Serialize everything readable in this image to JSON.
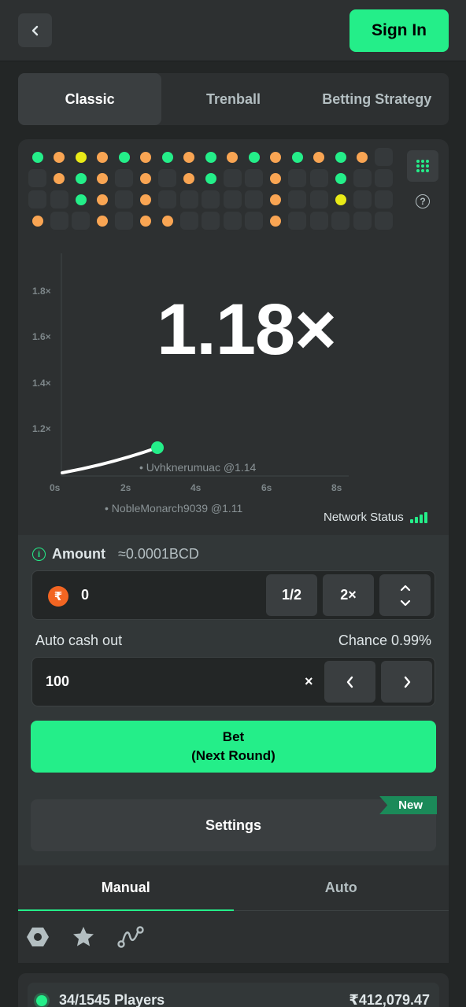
{
  "header": {
    "signin_label": "Sign In"
  },
  "tabs": [
    {
      "label": "Classic",
      "active": true
    },
    {
      "label": "Trenball",
      "active": false
    },
    {
      "label": "Betting Strategy",
      "active": false
    }
  ],
  "history": {
    "colors": {
      "g": "#24ee89",
      "o": "#f9a553",
      "y": "#e9ea17"
    },
    "rows": [
      [
        "g",
        "o",
        "y",
        "o",
        "g",
        "o",
        "g",
        "o",
        "g",
        "o",
        "g",
        "o",
        "g",
        "o",
        "g",
        "o",
        ""
      ],
      [
        "",
        "o",
        "g",
        "o",
        "",
        "o",
        "",
        "o",
        "g",
        "",
        "",
        "o",
        "",
        "",
        "g",
        "",
        ""
      ],
      [
        "",
        "",
        "g",
        "o",
        "",
        "o",
        "",
        "",
        "",
        "",
        "",
        "o",
        "",
        "",
        "y",
        "",
        ""
      ],
      [
        "o",
        "",
        "",
        "o",
        "",
        "o",
        "o",
        "",
        "",
        "",
        "",
        "o",
        "",
        "",
        "",
        "",
        ""
      ]
    ]
  },
  "graph": {
    "multiplier": "1.18×",
    "y_ticks": [
      "1.8×",
      "1.6×",
      "1.4×",
      "1.2×"
    ],
    "x_ticks": [
      "0s",
      "2s",
      "4s",
      "6s",
      "8s"
    ],
    "player_tags": [
      "• Uvhknerumuac @1.14",
      "• NobleMonarch9039 @1.11"
    ],
    "network_status": "Network Status"
  },
  "bet": {
    "amount_label": "Amount",
    "amount_approx": "≈0.0001BCD",
    "currency_symbol": "₹",
    "amount_value": "0",
    "half_label": "1/2",
    "double_label": "2×",
    "auto_cashout_label": "Auto cash out",
    "chance_label": "Chance 0.99%",
    "cashout_value": "100",
    "times_symbol": "×",
    "bet_label_line1": "Bet",
    "bet_label_line2": "(Next Round)",
    "settings_label": "Settings",
    "new_badge": "New"
  },
  "modes": [
    {
      "label": "Manual",
      "active": true
    },
    {
      "label": "Auto",
      "active": false
    }
  ],
  "players": {
    "count": "34/1545 Players",
    "total": "₹412,079.47"
  }
}
